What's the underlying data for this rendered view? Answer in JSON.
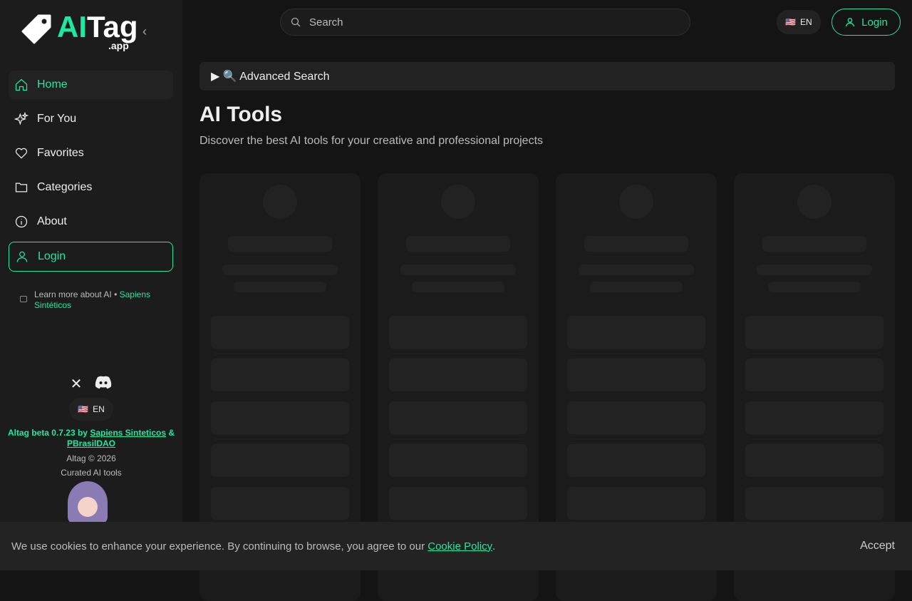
{
  "brand": {
    "ai": "AI",
    "tag": "Tag",
    "suffix": ".app"
  },
  "nav": [
    {
      "label": "Home"
    },
    {
      "label": "For You"
    },
    {
      "label": "Favorites"
    },
    {
      "label": "Categories"
    },
    {
      "label": "About"
    },
    {
      "label": "Login"
    }
  ],
  "learn": {
    "text": "Learn more about AI •",
    "link": "Sapiens Sintéticos"
  },
  "footer": {
    "lang": "EN",
    "flag": "🇺🇸",
    "version": "Altag beta 0.7.23 by",
    "link1": "Sapiens Sinteticos",
    "amp": "&",
    "link2": "PBrasilDAO",
    "copyright": "Altag © 2026",
    "tagline": "Curated AI tools"
  },
  "header": {
    "search_placeholder": "Search",
    "lang": "EN",
    "flag": "🇺🇸",
    "login": "Login"
  },
  "main": {
    "advanced": "▶ 🔍 Advanced Search",
    "title": "AI Tools",
    "subtitle": "Discover the best AI tools for your creative and professional projects"
  },
  "cookie": {
    "text": "We use cookies to enhance your experience. By continuing to browse, you agree to our",
    "link": "Cookie Policy",
    "period": ".",
    "accept": "Accept"
  },
  "colors": {
    "accent": "#1de9a0"
  }
}
